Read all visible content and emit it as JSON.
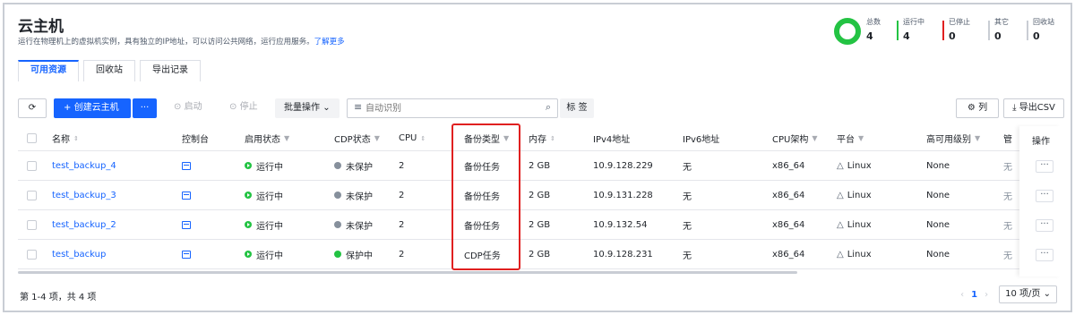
{
  "header": {
    "title": "云主机",
    "subtitle": "运行在物理机上的虚拟机实例，具有独立的IP地址，可以访问公共网络，运行应用服务。",
    "learn_more": "了解更多"
  },
  "stats": {
    "total_label": "总数",
    "total_value": "4",
    "running_label": "运行中",
    "running_value": "4",
    "stopped_label": "已停止",
    "stopped_value": "0",
    "other_label": "其它",
    "other_value": "0",
    "recycle_label": "回收站",
    "recycle_value": "0",
    "colors": {
      "running": "#23c343",
      "stopped": "#e02020",
      "neutral": "#c9cdd4"
    }
  },
  "tabs": [
    "可用资源",
    "回收站",
    "导出记录"
  ],
  "toolbar": {
    "refresh_icon": "refresh-icon",
    "create": "创建云主机",
    "more": "···",
    "start": "启动",
    "stop": "停止",
    "batch": "批量操作",
    "search_placeholder": "自动识别",
    "tags": "标 签",
    "columns": "列",
    "export": "导出CSV"
  },
  "columns": [
    "名称",
    "控制台",
    "启用状态",
    "CDP状态",
    "CPU",
    "备份类型",
    "内存",
    "IPv4地址",
    "IPv6地址",
    "CPU架构",
    "平台",
    "高可用级别",
    "管",
    "操作"
  ],
  "rows": [
    {
      "name": "test_backup_4",
      "status": "运行中",
      "cdp": "未保护",
      "cpu": "2",
      "backup": "备份任务",
      "mem": "2 GB",
      "ipv4": "10.9.128.229",
      "ipv6": "无",
      "arch": "x86_64",
      "platform": "Linux",
      "ha": "None",
      "mgmt": "无",
      "op": "···"
    },
    {
      "name": "test_backup_3",
      "status": "运行中",
      "cdp": "未保护",
      "cpu": "2",
      "backup": "备份任务",
      "mem": "2 GB",
      "ipv4": "10.9.131.228",
      "ipv6": "无",
      "arch": "x86_64",
      "platform": "Linux",
      "ha": "None",
      "mgmt": "无",
      "op": "···"
    },
    {
      "name": "test_backup_2",
      "status": "运行中",
      "cdp": "未保护",
      "cpu": "2",
      "backup": "备份任务",
      "mem": "2 GB",
      "ipv4": "10.9.132.54",
      "ipv6": "无",
      "arch": "x86_64",
      "platform": "Linux",
      "ha": "None",
      "mgmt": "无",
      "op": "···"
    },
    {
      "name": "test_backup",
      "status": "运行中",
      "cdp": "保护中",
      "cpu": "2",
      "backup": "CDP任务",
      "mem": "2 GB",
      "ipv4": "10.9.128.231",
      "ipv6": "无",
      "arch": "x86_64",
      "platform": "Linux",
      "ha": "None",
      "mgmt": "无",
      "op": "···"
    }
  ],
  "cdp_colors": {
    "未保护": "#86909c",
    "保护中": "#23c343"
  },
  "footer": {
    "count": "第 1-4 项，共 4 项",
    "page": "1",
    "page_size": "10 项/页"
  }
}
